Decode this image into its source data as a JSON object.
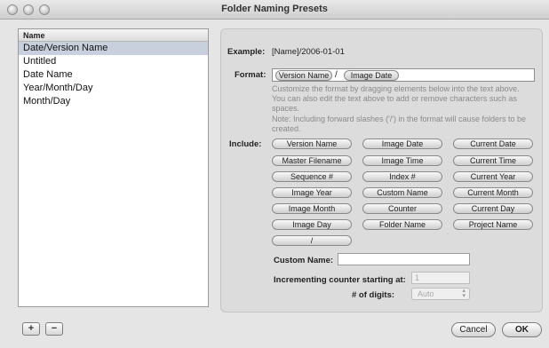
{
  "window": {
    "title": "Folder Naming Presets"
  },
  "list": {
    "header": "Name",
    "items": [
      {
        "label": "Date/Version Name",
        "selected": true
      },
      {
        "label": "Untitled",
        "selected": false
      },
      {
        "label": "Date Name",
        "selected": false
      },
      {
        "label": "Year/Month/Day",
        "selected": false
      },
      {
        "label": "Month/Day",
        "selected": false
      }
    ]
  },
  "example": {
    "label": "Example:",
    "value": "[Name]/2006-01-01"
  },
  "format": {
    "label": "Format:",
    "tokens": [
      "Version Name",
      "Image Date"
    ],
    "separator": "/",
    "help1": "Customize the format by dragging elements below into the text above. You can also edit the text above to add or remove characters such as spaces.",
    "help2": "Note: Including forward slashes ('/') in the format will cause folders to be created."
  },
  "include": {
    "label": "Include:",
    "chips": [
      "Version Name",
      "Image Date",
      "Current Date",
      "Master Filename",
      "Image Time",
      "Current Time",
      "Sequence #",
      "Index #",
      "Current Year",
      "Image Year",
      "Custom Name",
      "Current Month",
      "Image Month",
      "Counter",
      "Current Day",
      "Image Day",
      "Folder Name",
      "Project Name",
      "/"
    ]
  },
  "custom_name": {
    "label": "Custom Name:",
    "value": ""
  },
  "counter": {
    "label": "Incrementing counter starting at:",
    "value": "1"
  },
  "digits": {
    "label": "# of digits:",
    "value": "Auto"
  },
  "buttons": {
    "add": "+",
    "remove": "−",
    "cancel": "Cancel",
    "ok": "OK"
  }
}
